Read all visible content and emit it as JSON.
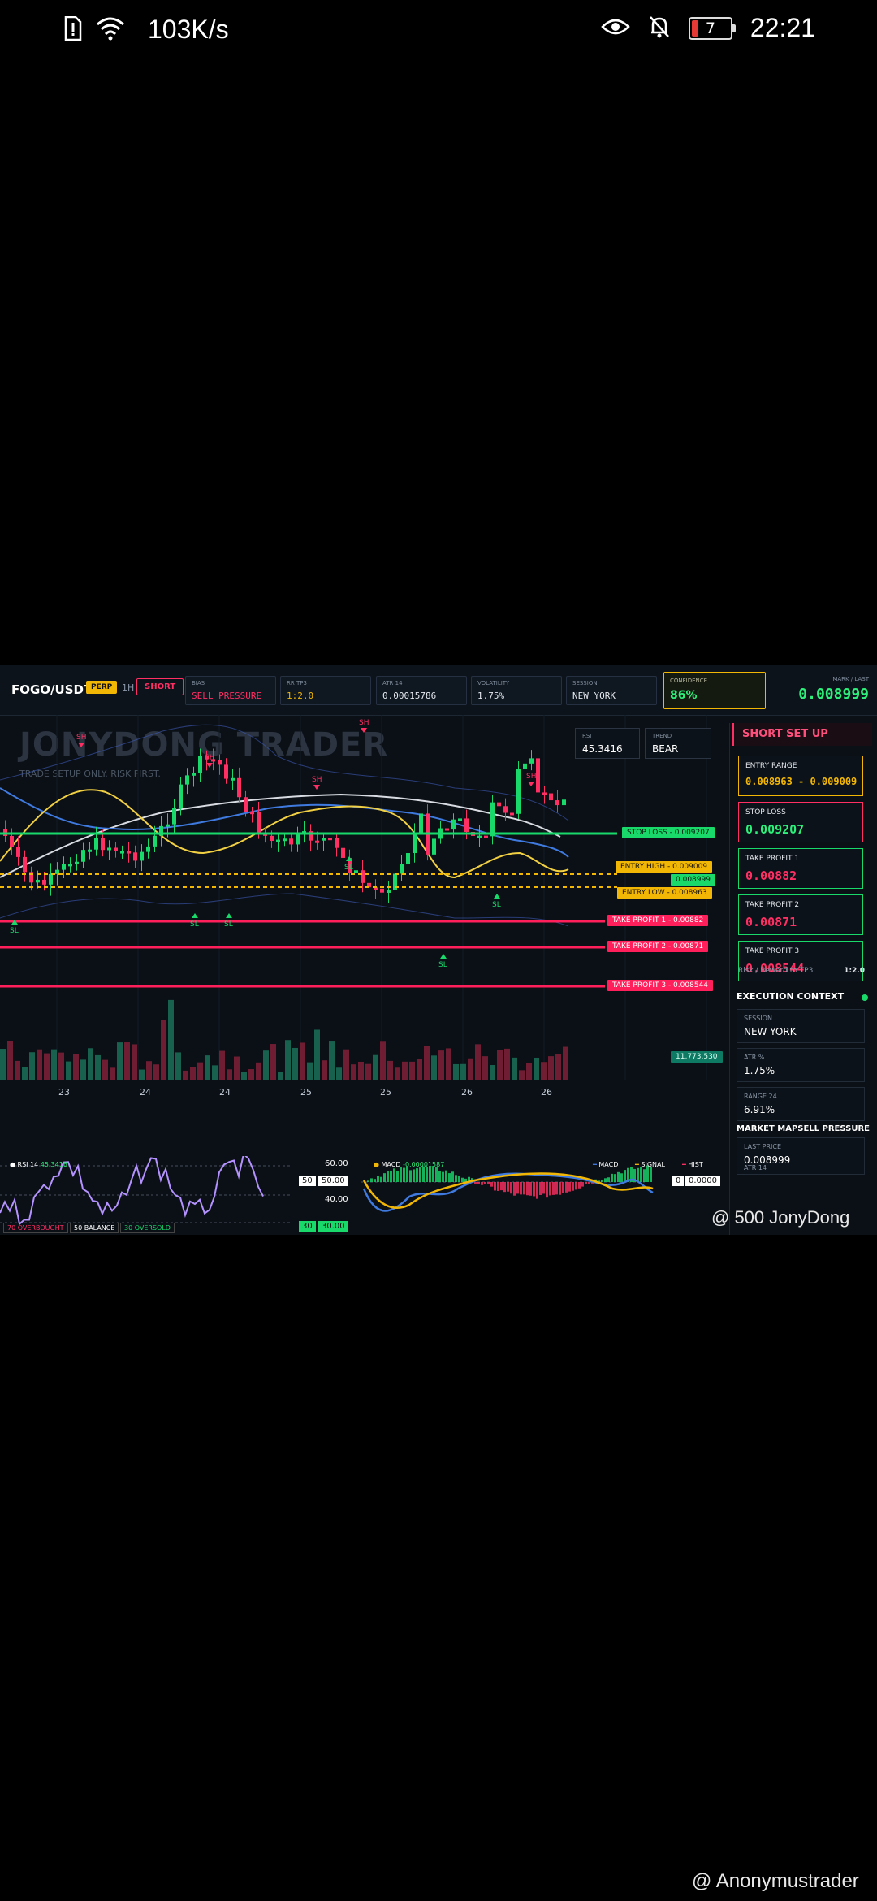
{
  "status_bar": {
    "net_speed": "103K/s",
    "battery": "7",
    "time": "22:21"
  },
  "header": {
    "pair": "FOGO/USDT",
    "perp": "PERP",
    "timeframe": "1H",
    "direction": "SHORT",
    "metrics": [
      {
        "label": "BIAS",
        "value": "SELL PRESSURE",
        "color": "#ff2e63"
      },
      {
        "label": "RR TP3",
        "value": "1:2.0",
        "color": "#f2b705"
      },
      {
        "label": "ATR 14",
        "value": "0.00015786",
        "color": "#e5e9ef"
      },
      {
        "label": "VOLATILITY",
        "value": "1.75%",
        "color": "#e5e9ef"
      },
      {
        "label": "SESSION",
        "value": "NEW YORK",
        "color": "#e5e9ef"
      }
    ],
    "confidence_label": "CONFIDENCE",
    "confidence_value": "86%",
    "mark_label": "MARK / LAST",
    "mark_value": "0.008999"
  },
  "chart": {
    "watermark": "JONYDONG TRADER",
    "subtitle": "TRADE SETUP ONLY. RISK FIRST.",
    "rsi_label": "RSI",
    "rsi_value": "45.3416",
    "trend_label": "TREND",
    "trend_value": "BEAR",
    "sh_label": "SH",
    "sl_label": "SL",
    "x_ticks": [
      "23",
      "24",
      "24",
      "25",
      "25",
      "26",
      "26"
    ],
    "levels": {
      "stop_loss": "STOP LOSS - 0.009207",
      "entry_high": "ENTRY HIGH - 0.009009",
      "last": "0.008999",
      "entry_low": "ENTRY LOW - 0.008963",
      "tp1": "TAKE PROFIT 1 - 0.00882",
      "tp2": "TAKE PROFIT 2 - 0.00871",
      "tp3": "TAKE PROFIT 3 - 0.008544",
      "volume": "11,773,530"
    }
  },
  "side": {
    "title": "SHORT SET UP",
    "entry_label": "ENTRY RANGE",
    "entry_value": "0.008963 - 0.009009",
    "sl_label": "STOP LOSS",
    "sl_value": "0.009207",
    "tp1_label": "TAKE PROFIT 1",
    "tp1_value": "0.00882",
    "tp2_label": "TAKE PROFIT 2",
    "tp2_value": "0.00871",
    "tp3_label": "TAKE PROFIT 3",
    "tp3_value": "0.008544",
    "rr_label": "Risk / Reward to TP3",
    "rr_value": "1:2.0",
    "exec_title": "EXECUTION CONTEXT",
    "session_label": "SESSION",
    "session_value": "NEW YORK",
    "atr_label": "ATR %",
    "atr_value": "1.75%",
    "range_label": "RANGE 24",
    "range_value": "6.91%",
    "market_map": "MARKET MAP",
    "market_state": "SELL PRESSURE",
    "last_price_label": "LAST PRICE",
    "last_price_value": "0.008999",
    "atr14_label": "ATR 14"
  },
  "rsi": {
    "label": "RSI 14",
    "value": "45.3416",
    "overbought": "70 OVERBOUGHT",
    "balance": "50 BALANCE",
    "oversold": "30 OVERSOLD",
    "axis_60": "60.00",
    "axis_50": "50",
    "axis_50b": "50.00",
    "axis_40": "40.00",
    "axis_30": "30",
    "axis_30b": "30.00"
  },
  "macd": {
    "label": "MACD",
    "value": "-0.00001587",
    "legend_macd": "MACD",
    "legend_signal": "SIGNAL",
    "legend_hist": "HIST",
    "zero_a": "0",
    "zero_b": "0.0000"
  },
  "overlays": {
    "wm1": "@ 500 JonyDong",
    "wm2": "@ Anonymustrader"
  },
  "colors": {
    "bull": "#19d96b",
    "bear": "#ff2e63",
    "gold": "#f2b705",
    "bg": "#0b1016"
  }
}
